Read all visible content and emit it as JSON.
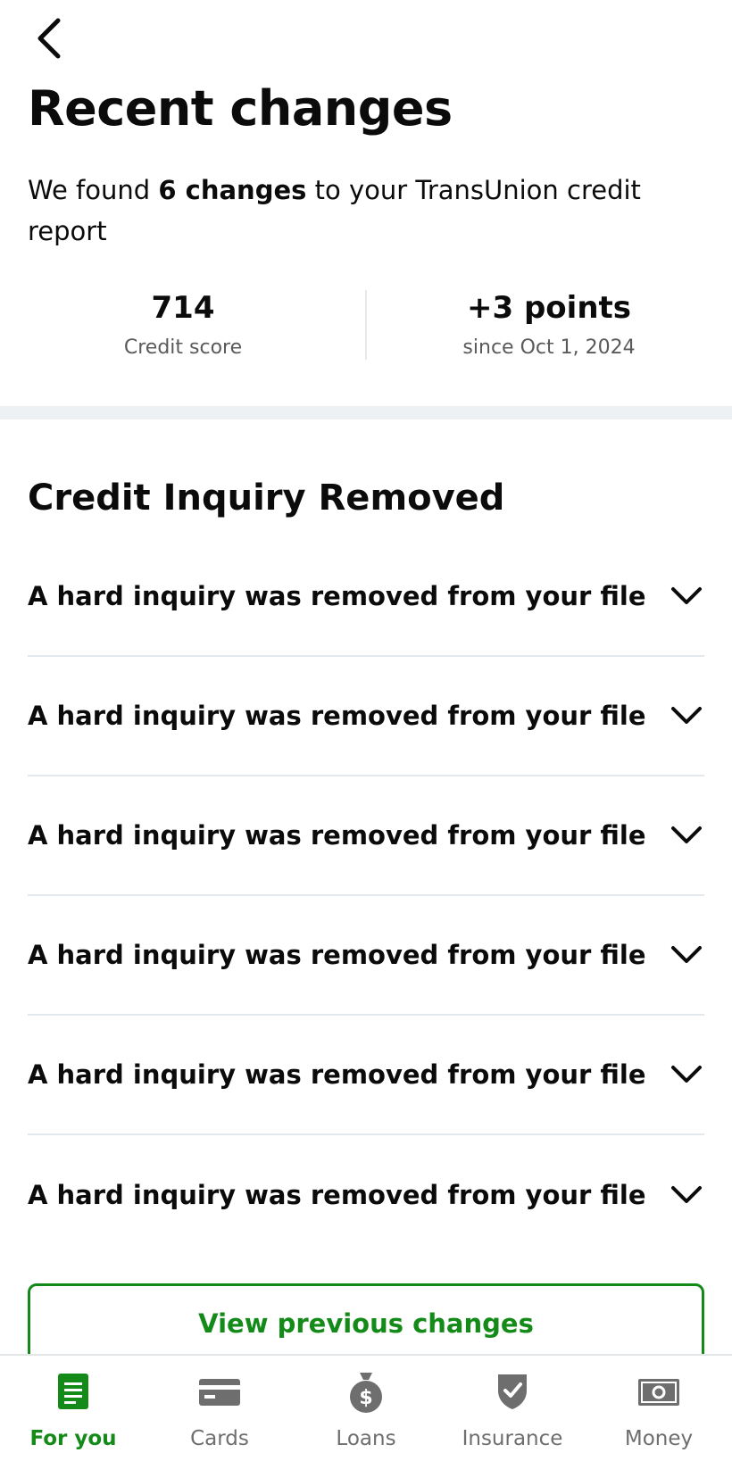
{
  "header": {
    "title": "Recent changes",
    "summary_prefix": "We found ",
    "summary_bold": "6 changes",
    "summary_suffix": " to your TransUnion credit report"
  },
  "stats": {
    "score_value": "714",
    "score_label": "Credit score",
    "change_value": "+3 points",
    "change_label": "since Oct 1, 2024"
  },
  "section": {
    "title": "Credit Inquiry Removed",
    "items": [
      {
        "label": "A hard inquiry was removed from your file"
      },
      {
        "label": "A hard inquiry was removed from your file"
      },
      {
        "label": "A hard inquiry was removed from your file"
      },
      {
        "label": "A hard inquiry was removed from your file"
      },
      {
        "label": "A hard inquiry was removed from your file"
      },
      {
        "label": "A hard inquiry was removed from your file"
      }
    ]
  },
  "view_previous_label": "View previous changes",
  "tabs": [
    {
      "label": "For you",
      "icon": "document-icon",
      "active": true
    },
    {
      "label": "Cards",
      "icon": "credit-card-icon",
      "active": false
    },
    {
      "label": "Loans",
      "icon": "money-bag-icon",
      "active": false
    },
    {
      "label": "Insurance",
      "icon": "shield-check-icon",
      "active": false
    },
    {
      "label": "Money",
      "icon": "banknote-icon",
      "active": false
    }
  ],
  "colors": {
    "accent": "#148a18",
    "inactive_tab": "#6e6e6e",
    "divider": "#e3e8ec"
  }
}
